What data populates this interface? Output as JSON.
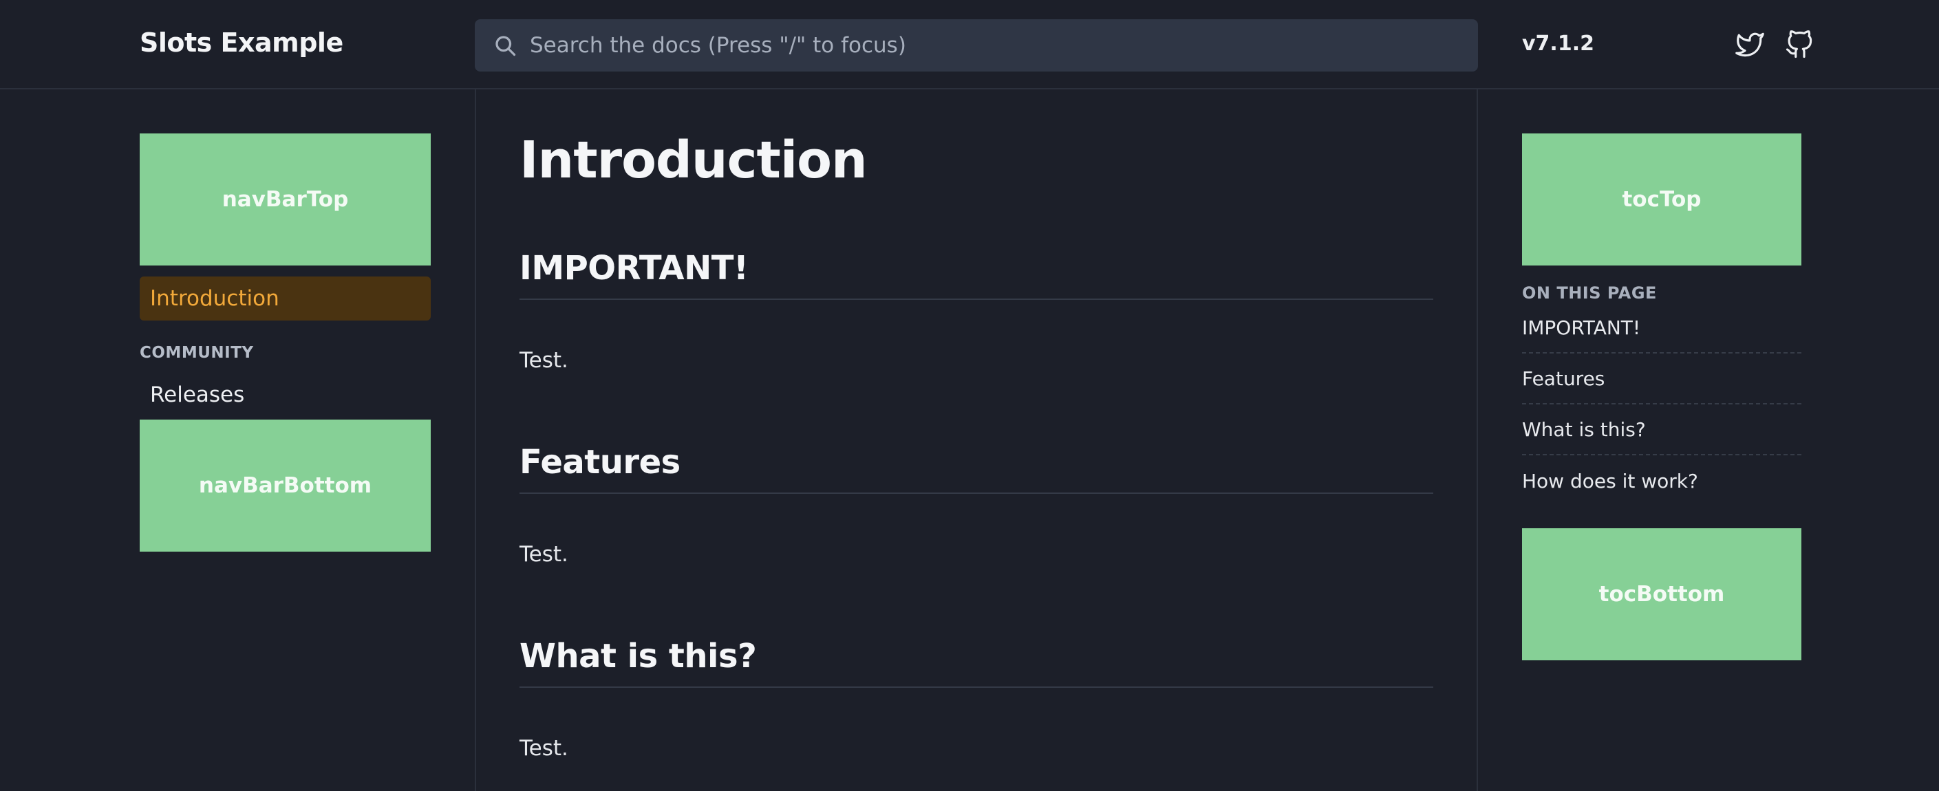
{
  "header": {
    "site_title": "Slots Example",
    "search_placeholder": "Search the docs (Press \"/\" to focus)",
    "version": "v7.1.2",
    "icons": [
      "twitter-icon",
      "github-icon"
    ]
  },
  "sidebar": {
    "slot_top": "navBarTop",
    "active_item": "Introduction",
    "section_title": "COMMUNITY",
    "items": [
      "Releases"
    ],
    "slot_bottom": "navBarBottom"
  },
  "main": {
    "title": "Introduction",
    "sections": [
      {
        "heading": "IMPORTANT!",
        "body": "Test."
      },
      {
        "heading": "Features",
        "body": "Test."
      },
      {
        "heading": "What is this?",
        "body": "Test."
      }
    ]
  },
  "toc": {
    "slot_top": "tocTop",
    "heading": "ON THIS PAGE",
    "items": [
      "IMPORTANT!",
      "Features",
      "What is this?",
      "How does it work?"
    ],
    "slot_bottom": "tocBottom"
  },
  "colors": {
    "background": "#1c1f29",
    "slot_green": "#86d096",
    "active_bg": "#4a3311",
    "active_text": "#f2a93a",
    "search_bg": "#2f3645"
  }
}
